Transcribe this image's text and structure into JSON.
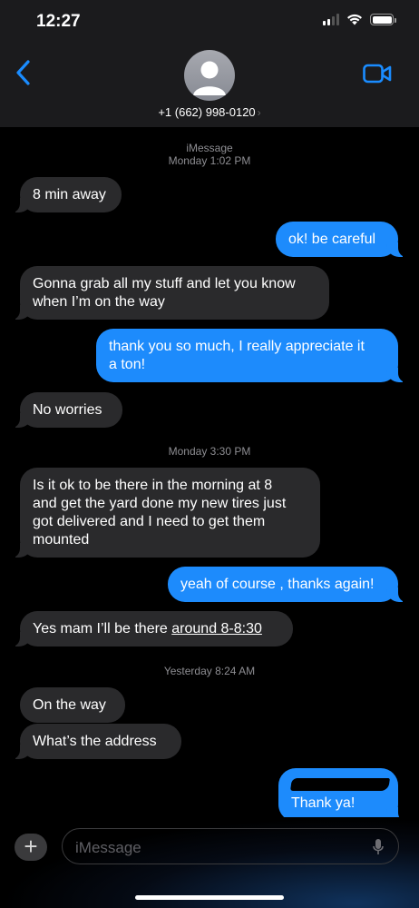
{
  "status_bar": {
    "time": "12:27"
  },
  "header": {
    "contact": "+1 (662) 998-0120",
    "chevron": "›",
    "back_icon": "chevron-left-icon",
    "video_icon": "video-camera-icon"
  },
  "thread": {
    "service_label": "iMessage",
    "stamp_1": "Monday 1:02 PM",
    "stamp_2": "Monday 3:30 PM",
    "stamp_3": "Yesterday 8:24 AM",
    "messages": [
      {
        "from": "them",
        "text": "8 min away"
      },
      {
        "from": "me",
        "text": "ok! be careful"
      },
      {
        "from": "them",
        "lines": [
          "Gonna grab all my stuff and let you know",
          "when I’m on the way"
        ]
      },
      {
        "from": "me",
        "lines": [
          "thank you so much, I really appreciate it",
          "a ton!"
        ]
      },
      {
        "from": "them",
        "text": "No worries"
      },
      {
        "from": "them",
        "lines": [
          "Is it ok to be there in the morning at 8",
          "and get the yard done my new tires just",
          "got delivered and I need to get them",
          "mounted"
        ]
      },
      {
        "from": "me",
        "text": "yeah of course , thanks again!"
      },
      {
        "from": "them",
        "text_start": "Yes mam I’ll be there ",
        "text_link": "around 8-8:30"
      },
      {
        "from": "them",
        "text": "On the way"
      },
      {
        "from": "them",
        "text": "What’s the address"
      },
      {
        "from": "me",
        "text": "Thank ya!"
      }
    ]
  },
  "composer": {
    "placeholder": "iMessage",
    "plus_label": "+",
    "mic_icon": "microphone-icon"
  },
  "colors": {
    "outgoing": "#1d8bfc",
    "incoming": "#2a2a2c",
    "accent": "#1a8cff",
    "header_bg": "#1b1b1d"
  }
}
